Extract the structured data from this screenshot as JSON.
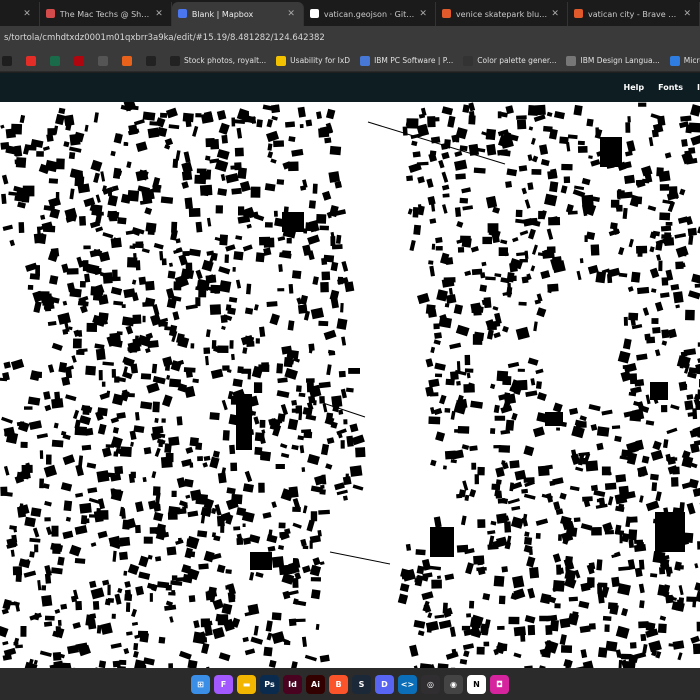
{
  "tabs": [
    {
      "label": "",
      "color": "#888888"
    },
    {
      "label": "The Mac Techs @ Sheridan :: La",
      "color": "#d44b4b"
    },
    {
      "label": "Blank | Mapbox",
      "color": "#4a76f0",
      "active": true
    },
    {
      "label": "vatican.geojson · GitHub",
      "color": "#ffffff"
    },
    {
      "label": "venice skatepark blueprints - B",
      "color": "#e05a2b"
    },
    {
      "label": "vatican city - Brave Search",
      "color": "#e05a2b"
    }
  ],
  "address": {
    "url": "s/tortola/cmhdtxdz0001m01qxbrr3a9ka/edit/#15.19/8.481282/124.642382"
  },
  "bookmarks": [
    {
      "label": "",
      "icon": "play-icon",
      "color": "#1e1e1e"
    },
    {
      "label": "",
      "icon": "youtube-icon",
      "color": "#e52d27"
    },
    {
      "label": "",
      "icon": "chat-icon",
      "color": "#1a6b4a"
    },
    {
      "label": "",
      "icon": "netflix-icon",
      "color": "#b0060f"
    },
    {
      "label": "",
      "icon": "d2l-icon",
      "color": "#555555"
    },
    {
      "label": "",
      "icon": "link-icon",
      "color": "#e8621b"
    },
    {
      "label": "",
      "icon": "k-icon",
      "color": "#222222"
    },
    {
      "label": "Stock photos, royalt...",
      "icon": "ss-icon",
      "color": "#222222"
    },
    {
      "label": "Usability for IxD",
      "icon": "ux-icon",
      "color": "#f2c200"
    },
    {
      "label": "IBM PC Software | P...",
      "icon": "ibm-icon",
      "color": "#4778d6"
    },
    {
      "label": "Color palette gener...",
      "icon": "palette-icon",
      "color": "#333333"
    },
    {
      "label": "IBM Design Langua...",
      "icon": "ibm-design-icon",
      "color": "#777777"
    },
    {
      "label": "Microsoft Wi",
      "icon": "windows-icon",
      "color": "#2f7de1"
    }
  ],
  "header_links": [
    {
      "label": "Help"
    },
    {
      "label": "Fonts"
    },
    {
      "label": "I"
    }
  ],
  "taskbar": [
    {
      "icon": "windows-start-icon",
      "color": "#3a8ee6",
      "glyph": "⊞"
    },
    {
      "icon": "figma-icon",
      "color": "#a259ff",
      "glyph": "F"
    },
    {
      "icon": "file-explorer-icon",
      "color": "#f2b500",
      "glyph": "▬"
    },
    {
      "icon": "photoshop-icon",
      "color": "#0b2b4e",
      "glyph": "Ps"
    },
    {
      "icon": "indesign-icon",
      "color": "#49021f",
      "glyph": "Id"
    },
    {
      "icon": "illustrator-icon",
      "color": "#330000",
      "glyph": "Ai"
    },
    {
      "icon": "brave-icon",
      "color": "#fb542b",
      "glyph": "B",
      "active": true
    },
    {
      "icon": "steam-icon",
      "color": "#1b2838",
      "glyph": "S"
    },
    {
      "icon": "discord-icon",
      "color": "#5865f2",
      "glyph": "D"
    },
    {
      "icon": "vscode-icon",
      "color": "#0a6fb8",
      "glyph": "<>"
    },
    {
      "icon": "obs-icon",
      "color": "#302e31",
      "glyph": "◎"
    },
    {
      "icon": "other-icon",
      "color": "#444444",
      "glyph": "◉"
    },
    {
      "icon": "notion-icon",
      "color": "#ffffff",
      "glyph": "N"
    },
    {
      "icon": "instagram-icon",
      "color": "#d6249f",
      "glyph": "◘"
    }
  ]
}
